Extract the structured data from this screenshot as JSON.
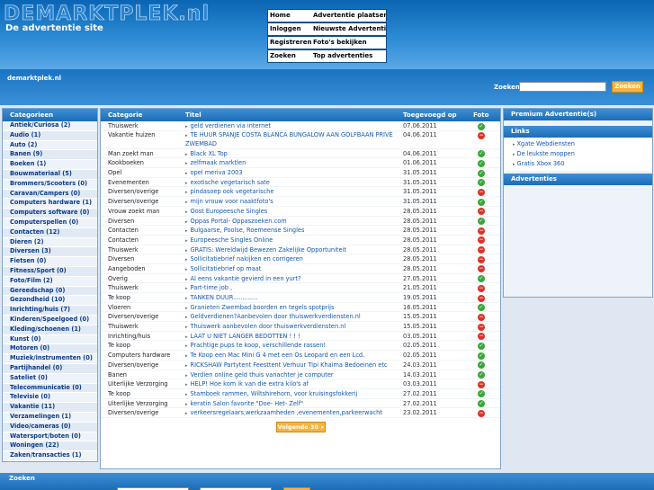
{
  "header": {
    "logo": "DEMARKTPLEK.nl",
    "tagline": "De advertentie site",
    "nav": [
      [
        "Home",
        "Advertentie plaatsen"
      ],
      [
        "Inloggen",
        "Nieuwste Advertenties"
      ],
      [
        "Registreren",
        "Foto's bekijken"
      ],
      [
        "Zoeken",
        "Top advertenties"
      ]
    ]
  },
  "site": {
    "name": "demarktplek.nl",
    "search_label": "Zoeken",
    "search_value": "",
    "search_button": "Zoeken"
  },
  "categories": {
    "title": "Categorieen",
    "items": [
      "Antiek/Curiosa (2)",
      "Audio (1)",
      "Auto (2)",
      "Banen (9)",
      "Boeken (1)",
      "Bouwmateriaal (5)",
      "Brommers/Scooters (0)",
      "Caravan/Campers (0)",
      "Computers hardware (1)",
      "Computers software (0)",
      "Computerspellen (0)",
      "Contacten (12)",
      "Dieren (2)",
      "Diversen (3)",
      "Fietsen (0)",
      "Fitness/Sport (0)",
      "Foto/Film (2)",
      "Gereedschap (0)",
      "Gezondheid (10)",
      "Inrichting/huis (7)",
      "Kinderen/Speelgoed (0)",
      "Kleding/schoenen (1)",
      "Kunst (0)",
      "Motoren (0)",
      "Muziek/instrumenten (0)",
      "Partijhandel (0)",
      "Sateliet (0)",
      "Telecommunicatie (0)",
      "Televisie (0)",
      "Vakantie (11)",
      "Verzamelingen (1)",
      "Video/cameras (0)",
      "Watersport/boten (0)",
      "Woningen (22)",
      "Zaken/transacties (1)"
    ]
  },
  "listings": {
    "headers": [
      "Categorie",
      "Titel",
      "Toegevoegd op",
      "Foto"
    ],
    "rows": [
      {
        "cat": "Thuiswerk",
        "title": "geld verdienen via internet",
        "date": "07.06.2011",
        "foto": "yes"
      },
      {
        "cat": "Vakantie huizen",
        "title": "TE HUUR SPANJE COSTA BLANCA BUNGALOW AAN GOLFBAAN PRIVÉ ZWEMBAD",
        "date": "04.06.2011",
        "foto": "no"
      },
      {
        "cat": "Man zoekt man",
        "title": "Black XL Top",
        "date": "04.06.2011",
        "foto": "yes"
      },
      {
        "cat": "Kookboeken",
        "title": "zelfmaak marktlen",
        "date": "01.06.2011",
        "foto": "yes"
      },
      {
        "cat": "Opel",
        "title": "opel meriva 2003",
        "date": "31.05.2011",
        "foto": "yes"
      },
      {
        "cat": "Evenementen",
        "title": "exotische vegetarisch sate",
        "date": "31.05.2011",
        "foto": "yes"
      },
      {
        "cat": "Diversen/overige",
        "title": "pindasoep ook vegetarische",
        "date": "31.05.2011",
        "foto": "no"
      },
      {
        "cat": "Diversen/overige",
        "title": "mijn vrouw voor naaktfoto's",
        "date": "31.05.2011",
        "foto": "yes"
      },
      {
        "cat": "Vrouw zoekt man",
        "title": "Oost Europeesche Singles",
        "date": "28.05.2011",
        "foto": "no"
      },
      {
        "cat": "Diversen",
        "title": "Oppas Portal- Oppaszoeken.com",
        "date": "28.05.2011",
        "foto": "yes"
      },
      {
        "cat": "Contacten",
        "title": "Bulgaarse, Poolse, Roemeense Singles",
        "date": "28.05.2011",
        "foto": "no"
      },
      {
        "cat": "Contacten",
        "title": "Europeesche Singles Online",
        "date": "28.05.2011",
        "foto": "no"
      },
      {
        "cat": "Thuiswerk",
        "title": "GRATIS: Wereldwijd Bewezen Zakelijke Opportuniteit",
        "date": "28.05.2011",
        "foto": "no"
      },
      {
        "cat": "Diversen",
        "title": "Sollicitatiebrief nakijken en corrigeren",
        "date": "28.05.2011",
        "foto": "no"
      },
      {
        "cat": "Aangeboden",
        "title": "Sollicitatiebrief op maat",
        "date": "28.05.2011",
        "foto": "no"
      },
      {
        "cat": "Overig",
        "title": "Al eens vakantie gevierd in een yurt?",
        "date": "27.05.2011",
        "foto": "yes"
      },
      {
        "cat": "Thuiswerk",
        "title": "Part-time job ,",
        "date": "21.05.2011",
        "foto": "no"
      },
      {
        "cat": "Te koop",
        "title": "TANKEN DUUR.............",
        "date": "19.05.2011",
        "foto": "no"
      },
      {
        "cat": "Vloeren",
        "title": "Granieten Zwembad boorden en tegels spotprijs",
        "date": "16.05.2011",
        "foto": "yes"
      },
      {
        "cat": "Diversen/overige",
        "title": "Geldverdienen?Aanbevolen door thuiswerkverdiensten.nl",
        "date": "15.05.2011",
        "foto": "no"
      },
      {
        "cat": "Thuiswerk",
        "title": "Thuiswerk aanbevolen door thuiswerkverdiensten.nl",
        "date": "15.05.2011",
        "foto": "no"
      },
      {
        "cat": "Inrichting/huis",
        "title": "LAAT U NIET LANGER BEDOTTEN ! ! !",
        "date": "03.05.2011",
        "foto": "no"
      },
      {
        "cat": "Te koop",
        "title": "Prachtige pups te koop, verschillende rassen!",
        "date": "02.05.2011",
        "foto": "yes"
      },
      {
        "cat": "Computers hardware",
        "title": "Te Koop een Mac Mini G 4 met een Os Leopard en een Lcd.",
        "date": "02.05.2011",
        "foto": "yes"
      },
      {
        "cat": "Diversen/overige",
        "title": "RICKSHAW Partytent Feesttent Verhuur Tipi Khaima Bedoeinen etc",
        "date": "24.03.2011",
        "foto": "yes"
      },
      {
        "cat": "Banen",
        "title": "Verdien online geld thuis vanachter je computer",
        "date": "14.03.2011",
        "foto": "yes"
      },
      {
        "cat": "Uiterlijke Verzorging",
        "title": "HELP! Hoe kom ik van die extra kilo's af",
        "date": "03.03.2011",
        "foto": "no"
      },
      {
        "cat": "Te koop",
        "title": "Stamboek rammen, Wiltshirehorn, voor kruisingsfokkerij",
        "date": "27.02.2011",
        "foto": "yes"
      },
      {
        "cat": "Uiterlijke Verzorging",
        "title": "keratin Salon favorite \"Doe- Het- Zelf\"",
        "date": "27.02.2011",
        "foto": "yes"
      },
      {
        "cat": "Diversen/overige",
        "title": "verkeersregelaars,werkzaamheden ,evenementen,parkeerwacht",
        "date": "23.02.2011",
        "foto": "no"
      }
    ],
    "next_label": "Volgende 30 »"
  },
  "right": {
    "premium_title": "Premium Advertentie(s)",
    "links_title": "Links",
    "links": [
      "Xgate Webdiensten",
      "De leukste moppen",
      "Gratis Xbox 360"
    ],
    "ads_title": "Advertenties"
  },
  "bottom": {
    "label": "Zoeken"
  },
  "colors": {
    "accent": "#1d6cb6",
    "button": "#f6b33d",
    "link": "#1058b0"
  }
}
